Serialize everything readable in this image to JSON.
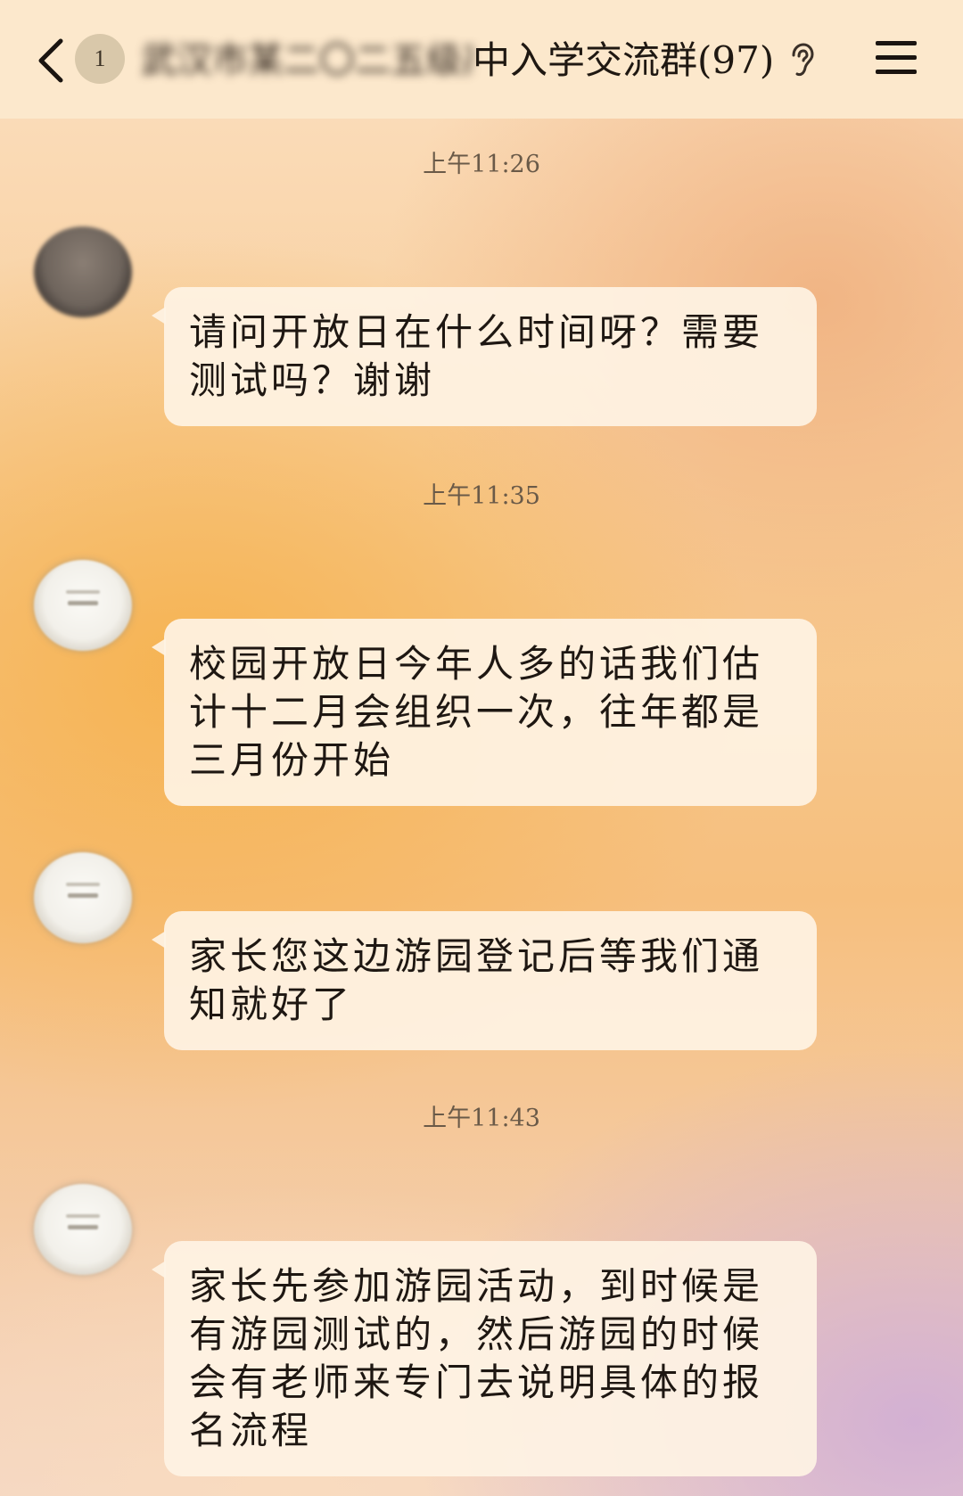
{
  "header": {
    "back_icon": "chevron-left-icon",
    "unread_count": "1",
    "title_blurred_prefix": "武汉市某二〇二五级高",
    "title": "中入学交流群(97)",
    "listen_icon": "ear-icon",
    "menu_icon": "hamburger-menu-icon"
  },
  "messages": [
    {
      "time": "上午11:26",
      "avatar": "dark-blurred-avatar",
      "text": "请问开放日在什么时间呀？需要测试吗？谢谢"
    },
    {
      "time": "上午11:35",
      "avatar": "face-avatar",
      "text": "校园开放日今年人多的话我们估计十二月会组织一次，往年都是三月份开始"
    },
    {
      "time": "",
      "avatar": "face-avatar",
      "text": "家长您这边游园登记后等我们通知就好了"
    },
    {
      "time": "上午11:43",
      "avatar": "face-avatar",
      "text": "家长先参加游园活动，到时候是有游园测试的，然后游园的时候会有老师来专门去说明具体的报名流程"
    }
  ],
  "colors": {
    "header_bg": "#fce8cc",
    "bubble_bg": "#fef3e4",
    "text": "#1e1712",
    "timestamp": "#6a5a48"
  }
}
